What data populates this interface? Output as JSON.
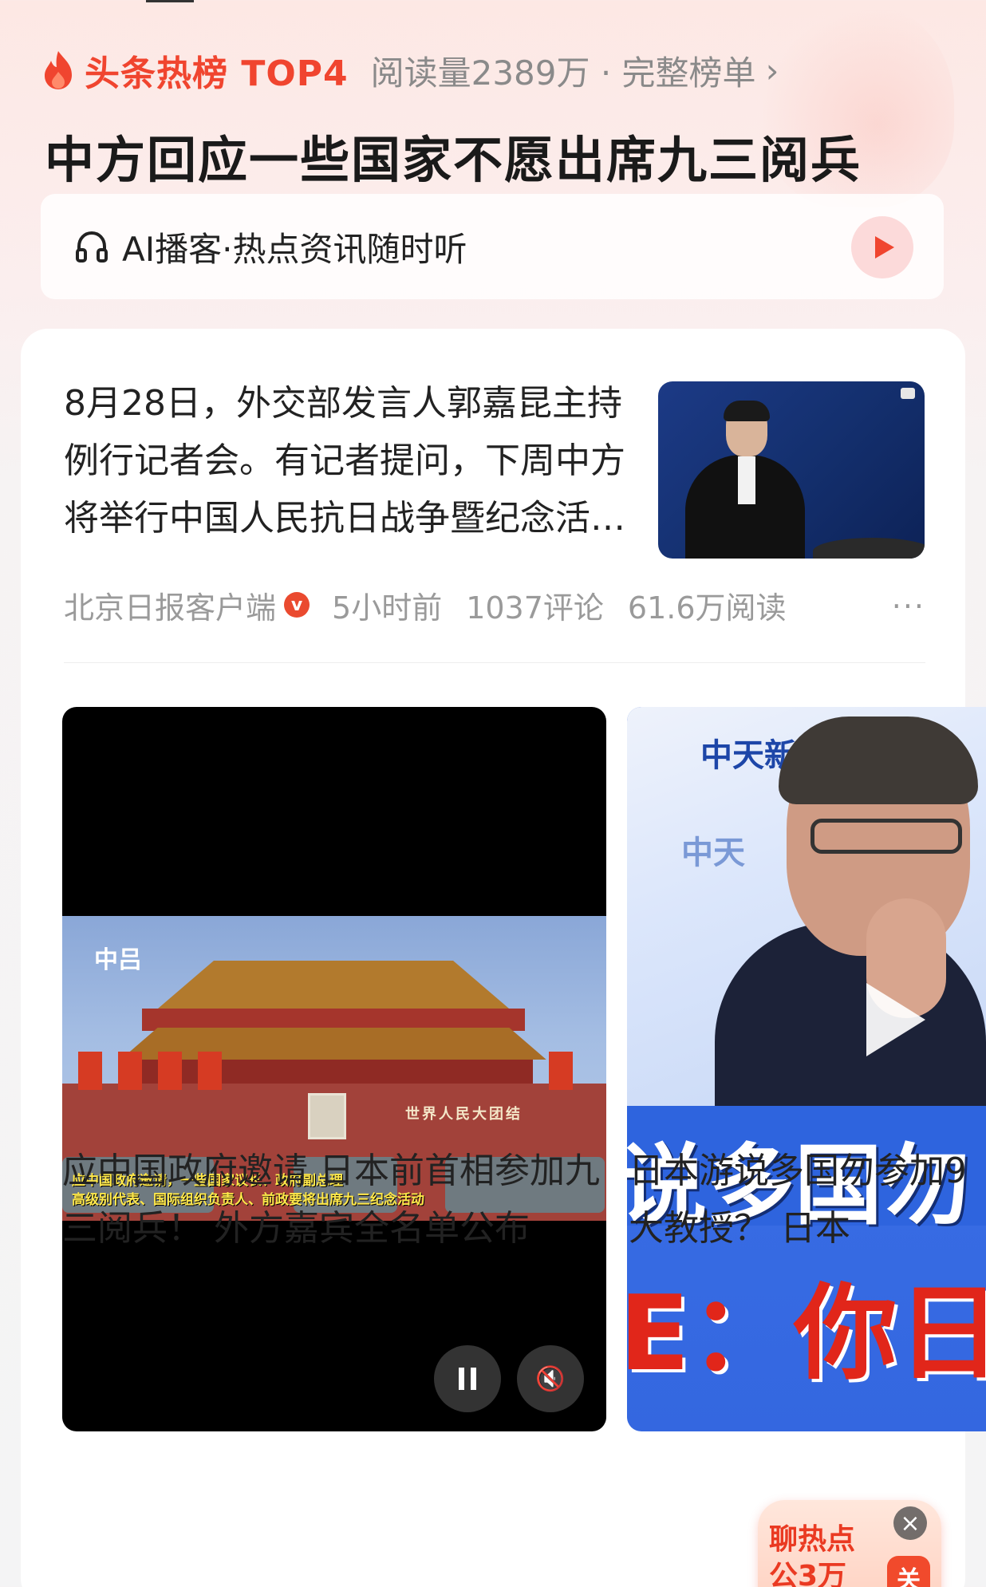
{
  "hot_rank": {
    "title": "头条热榜 TOP4",
    "meta": "阅读量2389万 · 完整榜单",
    "chevron": "›",
    "icon": "flame-icon",
    "color": "#f0452f"
  },
  "headline": "中方回应一些国家不愿出席九三阅兵",
  "podcast": {
    "label": "AI播客·热点资讯随时听",
    "icon": "headphones-icon",
    "play_icon": "play-icon"
  },
  "article": {
    "text": "8月28日，外交部发言人郭嘉昆主持例行记者会。有记者提问，下周中方将举行中国人民抗日战争暨纪念活动…",
    "source": "北京日报客户端",
    "verified_mark": "v",
    "time": "5小时前",
    "comments": "1037评论",
    "reads": "61.6万阅读",
    "more": "···"
  },
  "video_main": {
    "logo": "中吕",
    "banner": "世界人民大团结",
    "subtitle_line1": "应中国政府邀请，一些国家议长、政府副总理",
    "subtitle_line2": "高级别代表、国际组织负责人、前政要将出席九三纪念活动",
    "pause_icon": "pause-icon",
    "mute_icon": "mute-icon",
    "mute_glyph": "🔇",
    "caption": "应中国政府邀请 日本前首相参加九三阅兵！ 外方嘉宾全名单公布"
  },
  "video_side": {
    "logo_top": "中天新",
    "logo_mid": "中天",
    "overlay_line1": "说多国勿",
    "overlay_line2": "E：你日",
    "caption_line1": "日本游说多国勿参加9",
    "caption_line2": "大教授？    日本"
  },
  "chat_badge": {
    "label": "聊热点",
    "sub": "公3万",
    "close": "×",
    "icon_text": "关"
  }
}
